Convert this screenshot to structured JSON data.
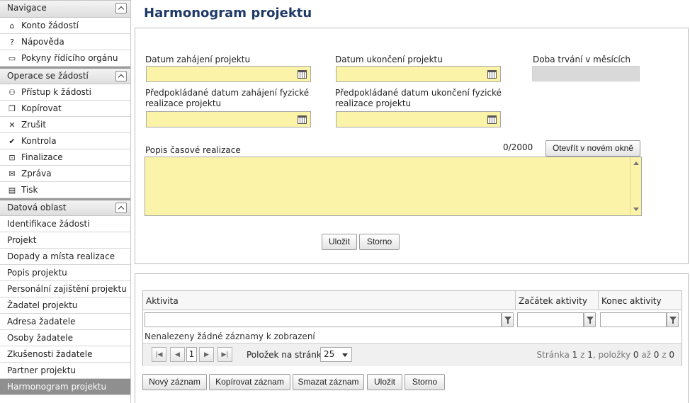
{
  "sidebar": {
    "sections": {
      "navigace": {
        "title": "Navigace",
        "items": [
          {
            "label": "Konto žádostí",
            "icon": "home-icon",
            "glyph": "⌂"
          },
          {
            "label": "Nápověda",
            "icon": "question-icon",
            "glyph": "?"
          },
          {
            "label": "Pokyny řídícího orgánu",
            "icon": "book-icon",
            "glyph": "▭"
          }
        ]
      },
      "operace": {
        "title": "Operace se žádostí",
        "items": [
          {
            "label": "Přístup k žádosti",
            "icon": "user-icon",
            "glyph": "⚇"
          },
          {
            "label": "Kopírovat",
            "icon": "copy-icon",
            "glyph": "❐"
          },
          {
            "label": "Zrušit",
            "icon": "cross-icon",
            "glyph": "✕"
          },
          {
            "label": "Kontrola",
            "icon": "check-icon",
            "glyph": "✔"
          },
          {
            "label": "Finalizace",
            "icon": "lock-icon",
            "glyph": "⊡"
          },
          {
            "label": "Zpráva",
            "icon": "envelope-icon",
            "glyph": "✉"
          },
          {
            "label": "Tisk",
            "icon": "print-icon",
            "glyph": "▤"
          }
        ]
      },
      "datova": {
        "title": "Datová oblast",
        "items": [
          "Identifikace žádosti",
          "Projekt",
          "Dopady a místa realizace",
          "Popis projektu",
          "Personální zajištění projektu",
          "Žadatel projektu",
          "Adresa žadatele",
          "Osoby žadatele",
          "Zkušenosti žadatele",
          "Partner projektu",
          "Harmonogram projektu"
        ],
        "active": "Harmonogram projektu"
      }
    }
  },
  "main": {
    "title": "Harmonogram projektu",
    "form": {
      "start_label": "Datum zahájení projektu",
      "end_label": "Datum ukončení projektu",
      "duration_label": "Doba trvání v měsících",
      "phys_start_label_1": "Předpokládané datum zahájení fyzické",
      "phys_start_label_2": "realizace projektu",
      "phys_end_label_1": "Předpokládané datum ukončení fyzické",
      "phys_end_label_2": "realizace projektu",
      "desc_label": "Popis časové realizace",
      "char_count": "0/2000",
      "open_window_label": "Otevřít v novém okně",
      "save_label": "Uložit",
      "cancel_label": "Storno"
    },
    "grid": {
      "columns": [
        "Aktivita",
        "Začátek aktivity",
        "Konec aktivity"
      ],
      "empty_message": "Nenalezeny žádné záznamy k zobrazení",
      "page_number": "1",
      "per_page_label": "Položek na stránku",
      "per_page_value": "25",
      "info_prefix": "Stránka ",
      "info_page": "1",
      "info_of": " z ",
      "info_pages": "1",
      "info_items": ", položky ",
      "info_from": "0",
      "info_to_word": " až ",
      "info_to": "0",
      "info_z": " z ",
      "info_total": "0"
    },
    "actions": {
      "new_label": "Nový záznam",
      "copy_label": "Kopírovat záznam",
      "delete_label": "Smazat záznam",
      "save_label": "Uložit",
      "cancel_label": "Storno"
    }
  }
}
